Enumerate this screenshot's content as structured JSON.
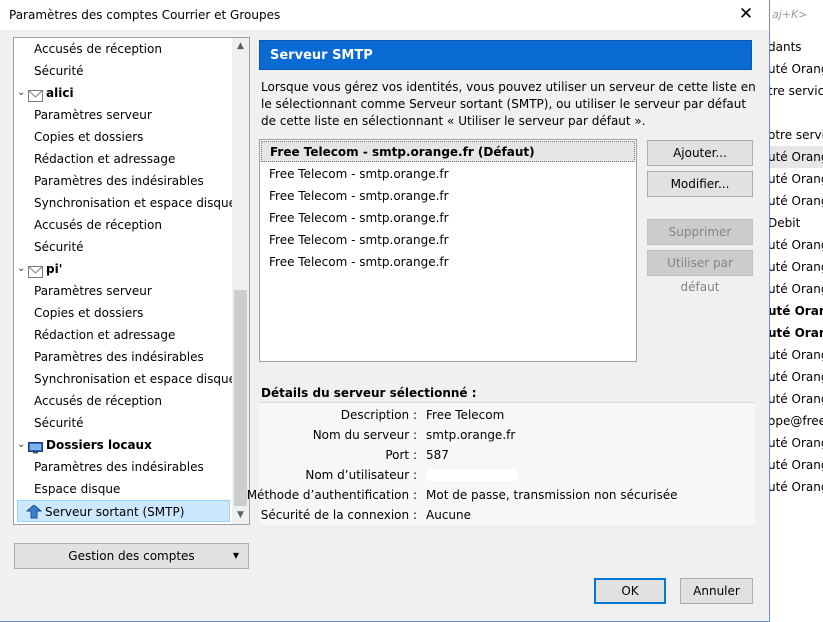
{
  "window": {
    "title": "Paramètres des comptes Courrier et Groupes",
    "close_glyph": "✕"
  },
  "background_app": {
    "shortcut_hint": "aj+K>",
    "rows": [
      {
        "text": "dants",
        "bold": false,
        "sel": false
      },
      {
        "text": "uté Orange",
        "bold": false,
        "sel": false
      },
      {
        "text": "tre service",
        "bold": false,
        "sel": false
      },
      {
        "text": "",
        "bold": false,
        "sel": false
      },
      {
        "text": "otre servic",
        "bold": false,
        "sel": false
      },
      {
        "text": "uté Orang",
        "bold": false,
        "sel": true
      },
      {
        "text": "uté Orang",
        "bold": false,
        "sel": false
      },
      {
        "text": "uté Orang",
        "bold": false,
        "sel": false
      },
      {
        "text": "Debit",
        "bold": false,
        "sel": false
      },
      {
        "text": "uté Orang",
        "bold": false,
        "sel": false
      },
      {
        "text": "uté Orang",
        "bold": false,
        "sel": false
      },
      {
        "text": "uté Orang",
        "bold": false,
        "sel": false
      },
      {
        "text": "uté Orang",
        "bold": true,
        "sel": false
      },
      {
        "text": "uté Orang",
        "bold": true,
        "sel": false
      },
      {
        "text": "uté Orang",
        "bold": false,
        "sel": false
      },
      {
        "text": "uté Orang",
        "bold": false,
        "sel": false
      },
      {
        "text": "uté Orang",
        "bold": false,
        "sel": false
      },
      {
        "text": "ope@free.f",
        "bold": false,
        "sel": false
      },
      {
        "text": "uté Orang",
        "bold": false,
        "sel": false
      },
      {
        "text": "uté Orang",
        "bold": false,
        "sel": false
      },
      {
        "text": "uté Orang",
        "bold": false,
        "sel": false
      }
    ]
  },
  "tree": {
    "items": [
      {
        "type": "child",
        "label": "Accusés de réception"
      },
      {
        "type": "child",
        "label": "Sécurité"
      },
      {
        "type": "parent",
        "label": "alici",
        "icon": "mail-account-icon"
      },
      {
        "type": "child",
        "label": "Paramètres serveur"
      },
      {
        "type": "child",
        "label": "Copies et dossiers"
      },
      {
        "type": "child",
        "label": "Rédaction et adressage"
      },
      {
        "type": "child",
        "label": "Paramètres des indésirables"
      },
      {
        "type": "child",
        "label": "Synchronisation et espace disque"
      },
      {
        "type": "child",
        "label": "Accusés de réception"
      },
      {
        "type": "child",
        "label": "Sécurité"
      },
      {
        "type": "parent",
        "label": "pi'",
        "icon": "mail-account-icon"
      },
      {
        "type": "child",
        "label": "Paramètres serveur"
      },
      {
        "type": "child",
        "label": "Copies et dossiers"
      },
      {
        "type": "child",
        "label": "Rédaction et adressage"
      },
      {
        "type": "child",
        "label": "Paramètres des indésirables"
      },
      {
        "type": "child",
        "label": "Synchronisation et espace disque"
      },
      {
        "type": "child",
        "label": "Accusés de réception"
      },
      {
        "type": "child",
        "label": "Sécurité"
      },
      {
        "type": "parent",
        "label": "Dossiers locaux",
        "icon": "local-folders-icon"
      },
      {
        "type": "child",
        "label": "Paramètres des indésirables"
      },
      {
        "type": "child",
        "label": "Espace disque"
      },
      {
        "type": "selected",
        "label": "Serveur sortant (SMTP)",
        "icon": "outgoing-server-icon"
      }
    ],
    "scroll_up": "▲",
    "scroll_down": "▼"
  },
  "manage_accounts": {
    "label": "Gestion des comptes",
    "arrow": "▼"
  },
  "smtp": {
    "header": "Serveur SMTP",
    "description": "Lorsque vous gérez vos identités, vous pouvez utiliser un serveur de cette liste en le sélectionnant comme Serveur sortant (SMTP), ou utiliser le serveur par défaut de cette liste en sélectionnant « Utiliser le serveur par défaut ».",
    "servers": [
      "Free Telecom - smtp.orange.fr (Défaut)",
      "Free Telecom - smtp.orange.fr",
      "Free Telecom - smtp.orange.fr",
      "Free Telecom - smtp.orange.fr",
      "Free Telecom - smtp.orange.fr",
      "Free Telecom - smtp.orange.fr"
    ],
    "buttons": {
      "add": "Ajouter...",
      "edit": "Modifier...",
      "delete": "Supprimer",
      "set_default": "Utiliser par défaut"
    }
  },
  "details": {
    "title": "Détails du serveur sélectionné :",
    "rows": [
      {
        "label": "Description :",
        "value": "Free Telecom"
      },
      {
        "label": "Nom du serveur :",
        "value": "smtp.orange.fr"
      },
      {
        "label": "Port :",
        "value": "587"
      },
      {
        "label": "Nom d’utilisateur :",
        "value": ""
      },
      {
        "label": "Méthode d’authentification :",
        "value": "Mot de passe, transmission non sécurisée"
      },
      {
        "label": "Sécurité de la connexion :",
        "value": "Aucune"
      }
    ]
  },
  "footer": {
    "ok": "OK",
    "cancel": "Annuler"
  }
}
